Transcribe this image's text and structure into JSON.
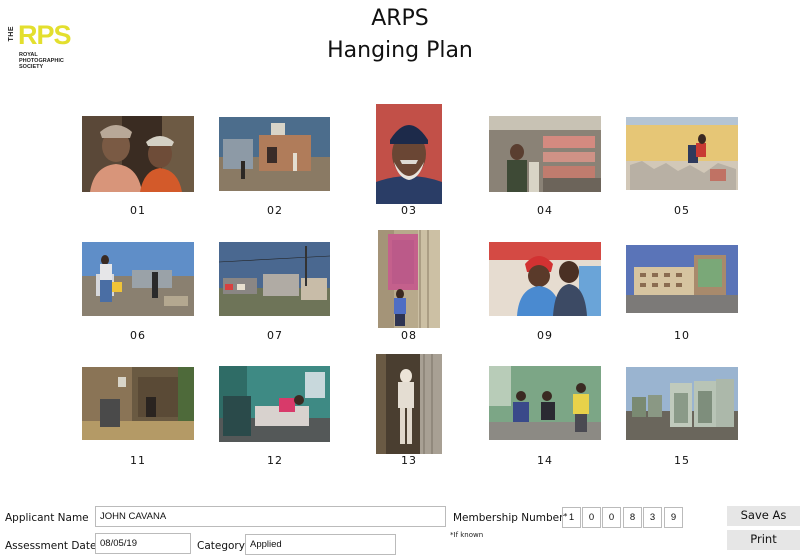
{
  "logo": {
    "the": "THE",
    "rps": "RPS",
    "line1": "ROYAL",
    "line2": "PHOTOGRAPHIC",
    "line3": "SOCIETY",
    "accent_color": "#e3df2e"
  },
  "title": {
    "line1": "ARPS",
    "line2": "Hanging Plan"
  },
  "photos": [
    {
      "label": "01"
    },
    {
      "label": "02"
    },
    {
      "label": "03"
    },
    {
      "label": "04"
    },
    {
      "label": "05"
    },
    {
      "label": "06"
    },
    {
      "label": "07"
    },
    {
      "label": "08"
    },
    {
      "label": "09"
    },
    {
      "label": "10"
    },
    {
      "label": "11"
    },
    {
      "label": "12"
    },
    {
      "label": "13"
    },
    {
      "label": "14"
    },
    {
      "label": "15"
    }
  ],
  "form": {
    "applicant_label": "Applicant Name",
    "applicant_value": "JOHN CAVANA",
    "assessment_label": "Assessment Date",
    "assessment_value": "08/05/19",
    "category_label": "Category",
    "category_value": "Applied",
    "membership_label": "Membership Number",
    "membership_asterisk": "*",
    "membership_digits": [
      "1",
      "0",
      "0",
      "8",
      "3",
      "9"
    ],
    "if_known": "*If known"
  },
  "buttons": {
    "save_as": "Save As",
    "print": "Print"
  }
}
